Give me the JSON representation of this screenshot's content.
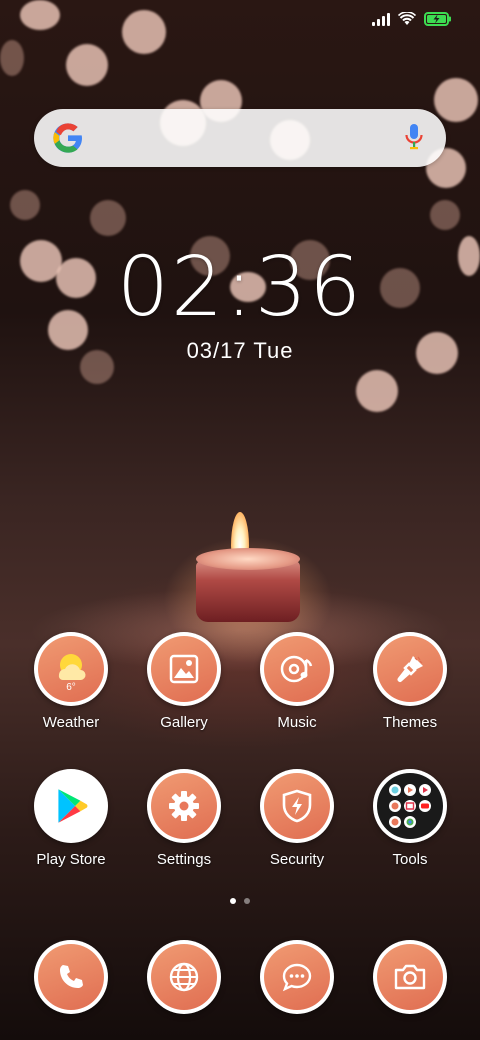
{
  "status_bar": {
    "icons": [
      "signal-icon",
      "wifi-icon",
      "battery-charging-icon"
    ],
    "battery_color": "#3ddc52"
  },
  "search_bar": {
    "left_icon": "google-g-icon",
    "right_icon": "mic-icon"
  },
  "clock": {
    "time": "02:36",
    "date": "03/17 Tue"
  },
  "apps_row1": [
    {
      "label": "Weather",
      "icon": "weather-icon",
      "temp": "6°"
    },
    {
      "label": "Gallery",
      "icon": "gallery-icon"
    },
    {
      "label": "Music",
      "icon": "music-icon"
    },
    {
      "label": "Themes",
      "icon": "themes-brush-icon"
    }
  ],
  "apps_row2": [
    {
      "label": "Play Store",
      "icon": "play-store-icon"
    },
    {
      "label": "Settings",
      "icon": "gear-icon"
    },
    {
      "label": "Security",
      "icon": "security-shield-icon"
    },
    {
      "label": "Tools",
      "icon": "tools-folder-icon"
    }
  ],
  "page_indicator": {
    "pages": 2,
    "current": 1
  },
  "dock": [
    {
      "icon": "phone-icon"
    },
    {
      "icon": "browser-globe-icon"
    },
    {
      "icon": "messages-icon"
    },
    {
      "icon": "camera-icon"
    }
  ],
  "colors": {
    "icon_accent": "#e8775a",
    "icon_ring": "#ffffff"
  }
}
